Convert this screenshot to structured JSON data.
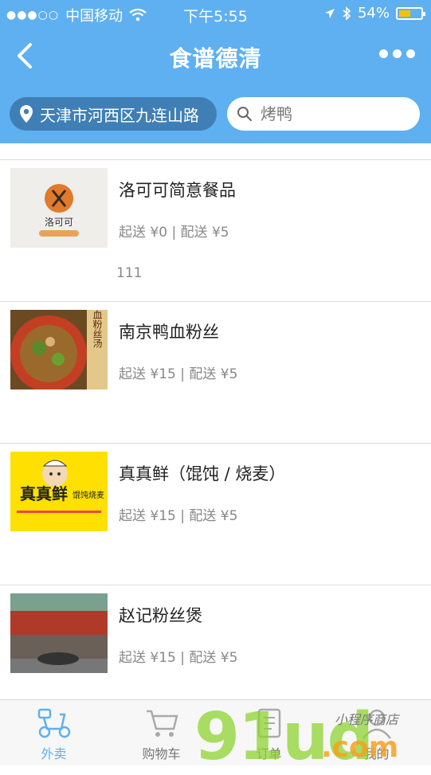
{
  "status_bar": {
    "carrier": "中国移动",
    "time": "下午5:55",
    "battery": "54%"
  },
  "navbar": {
    "title": "食谱德清"
  },
  "location": {
    "text": "天津市河西区九连山路"
  },
  "search": {
    "placeholder": "烤鸭"
  },
  "restaurants": [
    {
      "name": "洛可可简意餐品",
      "meta": "起送 ¥0 | 配送 ¥5",
      "extra": "111",
      "thumb_text": "洛可可"
    },
    {
      "name": "南京鸭血粉丝",
      "meta": "起送 ¥15 | 配送 ¥5",
      "extra": "",
      "thumb_text": "鸭血粉丝汤"
    },
    {
      "name": "真真鲜（馄饨 / 烧麦）",
      "meta": "起送 ¥15 | 配送 ¥5",
      "extra": "",
      "thumb_text": "真真鲜",
      "thumb_text2": "馄饨烧麦"
    },
    {
      "name": "赵记粉丝煲",
      "meta": "起送 ¥15 | 配送 ¥5",
      "extra": ""
    }
  ],
  "tabs": [
    {
      "label": "外卖",
      "icon": "scooter-icon",
      "active": true
    },
    {
      "label": "购物车",
      "icon": "cart-icon"
    },
    {
      "label": "订单",
      "icon": "order-icon"
    },
    {
      "label": "我的",
      "icon": "user-icon"
    }
  ],
  "watermark": {
    "main": "91ud",
    "suffix": ".com",
    "tagline": "小程序商店"
  },
  "colors": {
    "header": "#5fb0f0",
    "location_pill": "#3f7fb6",
    "active_tab": "#5fb0f0"
  }
}
